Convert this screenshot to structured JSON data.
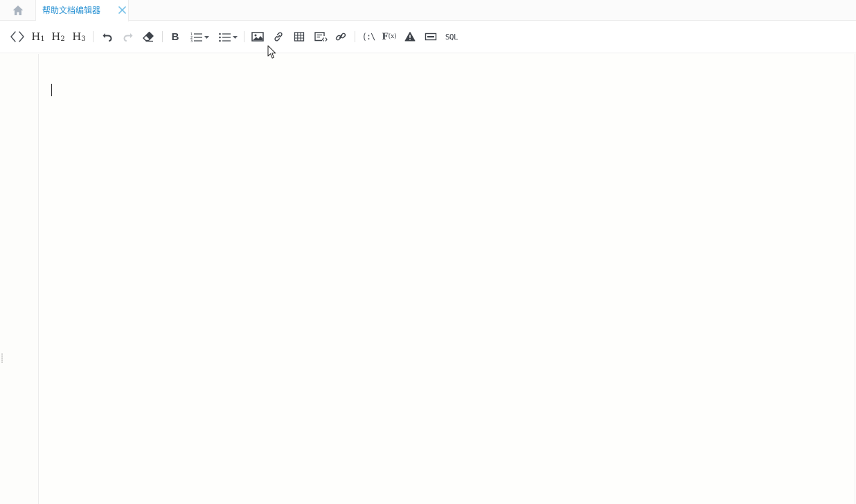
{
  "tabs": {
    "home_icon": "home-icon",
    "active_tab_label": "帮助文档编辑器",
    "close_icon": "close-icon",
    "active_color": "#2a92d3"
  },
  "toolbar": {
    "buttons": [
      {
        "name": "source-code-button",
        "icon": "code-brackets-icon"
      },
      {
        "name": "heading-1-button",
        "label_main": "H",
        "label_sub": "1"
      },
      {
        "name": "heading-2-button",
        "label_main": "H",
        "label_sub": "2"
      },
      {
        "name": "heading-3-button",
        "label_main": "H",
        "label_sub": "3"
      },
      {
        "name": "undo-button",
        "icon": "undo-icon"
      },
      {
        "name": "redo-button",
        "icon": "redo-icon",
        "disabled": true
      },
      {
        "name": "clear-format-button",
        "icon": "eraser-icon"
      },
      {
        "name": "bold-button",
        "label": "B"
      },
      {
        "name": "ordered-list-button",
        "icon": "ordered-list-icon"
      },
      {
        "name": "unordered-list-button",
        "icon": "unordered-list-icon"
      },
      {
        "name": "insert-image-button",
        "icon": "image-icon"
      },
      {
        "name": "insert-link-button",
        "icon": "link-icon"
      },
      {
        "name": "insert-table-button",
        "icon": "table-icon"
      },
      {
        "name": "insert-code-block-button",
        "icon": "code-block-icon"
      },
      {
        "name": "insert-anchor-button",
        "icon": "chain-link-icon"
      },
      {
        "name": "insert-path-button",
        "label": "(:\\"
      },
      {
        "name": "insert-function-button",
        "label_main": "F",
        "label_sub": "(x)"
      },
      {
        "name": "insert-warning-button",
        "icon": "warning-icon"
      },
      {
        "name": "insert-field-button",
        "icon": "field-box-icon"
      },
      {
        "name": "insert-sql-button",
        "label": "SQL"
      }
    ]
  },
  "editor": {
    "content": "",
    "caret_visible": true
  }
}
